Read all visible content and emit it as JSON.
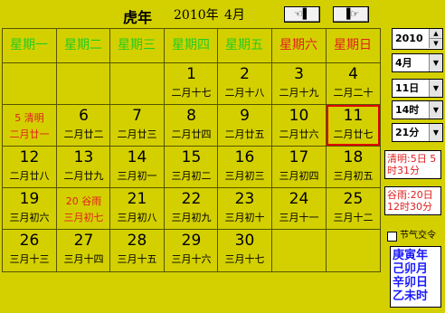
{
  "title": {
    "year_label": "虎年",
    "date_label": "2010年",
    "month_label": "4月"
  },
  "nav": {
    "prev_label": "☜▌",
    "next_label": "▐☞"
  },
  "weekdays": [
    "星期一",
    "星期二",
    "星期三",
    "星期四",
    "星期五",
    "星期六",
    "星期日"
  ],
  "weeks": [
    [
      {
        "d": "",
        "l": ""
      },
      {
        "d": "",
        "l": ""
      },
      {
        "d": "",
        "l": ""
      },
      {
        "d": "1",
        "l": "二月十七"
      },
      {
        "d": "2",
        "l": "二月十八"
      },
      {
        "d": "3",
        "l": "二月十九"
      },
      {
        "d": "4",
        "l": "二月二十"
      }
    ],
    [
      {
        "d": "5 清明",
        "l": "二月廿一",
        "red": true,
        "small": true
      },
      {
        "d": "6",
        "l": "二月廿二"
      },
      {
        "d": "7",
        "l": "二月廿三"
      },
      {
        "d": "8",
        "l": "二月廿四"
      },
      {
        "d": "9",
        "l": "二月廿五"
      },
      {
        "d": "10",
        "l": "二月廿六"
      },
      {
        "d": "11",
        "l": "二月廿七",
        "today": true
      }
    ],
    [
      {
        "d": "12",
        "l": "二月廿八"
      },
      {
        "d": "13",
        "l": "二月廿九"
      },
      {
        "d": "14",
        "l": "三月初一"
      },
      {
        "d": "15",
        "l": "三月初二"
      },
      {
        "d": "16",
        "l": "三月初三"
      },
      {
        "d": "17",
        "l": "三月初四"
      },
      {
        "d": "18",
        "l": "三月初五"
      }
    ],
    [
      {
        "d": "19",
        "l": "三月初六"
      },
      {
        "d": "20 谷雨",
        "l": "三月初七",
        "red": true,
        "small": true
      },
      {
        "d": "21",
        "l": "三月初八"
      },
      {
        "d": "22",
        "l": "三月初九"
      },
      {
        "d": "23",
        "l": "三月初十"
      },
      {
        "d": "24",
        "l": "三月十一"
      },
      {
        "d": "25",
        "l": "三月十二"
      }
    ],
    [
      {
        "d": "26",
        "l": "三月十三"
      },
      {
        "d": "27",
        "l": "三月十四"
      },
      {
        "d": "28",
        "l": "三月十五"
      },
      {
        "d": "29",
        "l": "三月十六"
      },
      {
        "d": "30",
        "l": "三月十七"
      },
      {
        "d": "",
        "l": ""
      },
      {
        "d": "",
        "l": ""
      }
    ]
  ],
  "controls": {
    "year": "2010",
    "month": "4月",
    "day": "11日",
    "hour": "14时",
    "minute": "21分"
  },
  "solar_terms": {
    "qingming": "清明:5日 5时31分",
    "guyu": "谷雨:20日 12时30分"
  },
  "checkbox": {
    "label": "节气交令",
    "checked": false
  },
  "ganzhi": [
    "庚寅年",
    "己卯月",
    "辛卯日",
    "乙未时"
  ],
  "colors": {
    "background": "#d4d000",
    "weekday": "#22cc22",
    "weekend": "#e02020",
    "ganzhi": "#1a1aff"
  }
}
